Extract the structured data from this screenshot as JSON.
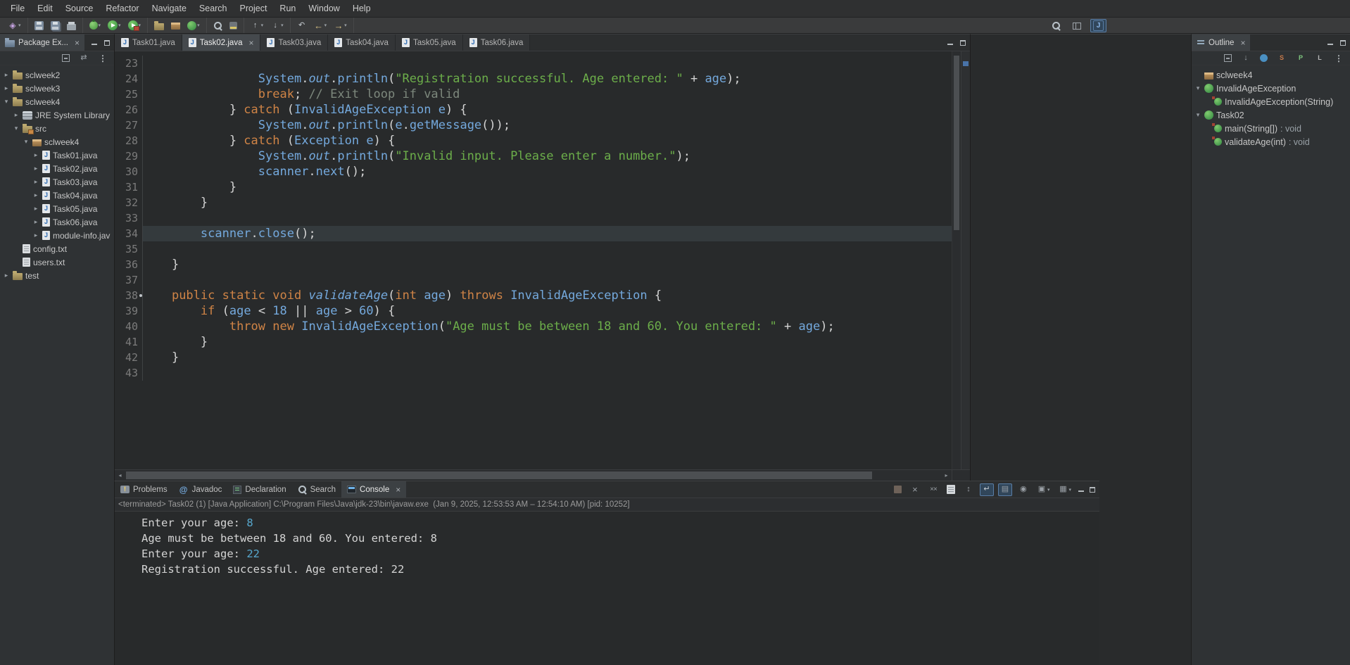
{
  "colors": {
    "keyword": "#d08446",
    "string": "#6cae4a",
    "comment": "#7d887d",
    "blue": "#74a9dd",
    "plain": "#d4d4d4",
    "stdin": "#57a8ce",
    "accent": "#4973a8"
  },
  "menubar": {
    "items": [
      "File",
      "Edit",
      "Source",
      "Refactor",
      "Navigate",
      "Search",
      "Project",
      "Run",
      "Window",
      "Help"
    ]
  },
  "toolbar": {
    "groups": [
      [
        {
          "name": "new-wizard-icon",
          "dropdown": true
        }
      ],
      [
        {
          "name": "save-icon"
        },
        {
          "name": "save-all-icon"
        },
        {
          "name": "print-icon"
        }
      ],
      [
        {
          "name": "debug-icon",
          "dropdown": true
        },
        {
          "name": "run-icon",
          "dropdown": true
        },
        {
          "name": "external-tools-icon",
          "dropdown": true
        }
      ],
      [
        {
          "name": "new-java-project-icon"
        },
        {
          "name": "new-package-icon"
        },
        {
          "name": "new-class-icon",
          "dropdown": true
        }
      ],
      [
        {
          "name": "search-toolbar-icon"
        },
        {
          "name": "mark-occurrences-icon"
        }
      ],
      [
        {
          "name": "previous-annotation-icon",
          "dropdown": true
        },
        {
          "name": "next-annotation-icon",
          "dropdown": true
        }
      ],
      [
        {
          "name": "last-edit-location-icon"
        },
        {
          "name": "back-icon",
          "dropdown": true
        },
        {
          "name": "forward-icon",
          "dropdown": true
        }
      ]
    ],
    "right": [
      {
        "name": "search-icon"
      },
      {
        "name": "open-perspective-icon"
      },
      {
        "name": "java-perspective-icon",
        "active": true
      }
    ]
  },
  "package_explorer": {
    "title": "Package Ex...",
    "tools": [
      {
        "name": "collapse-all-icon"
      },
      {
        "name": "link-with-editor-icon"
      },
      {
        "name": "view-menu-icon"
      }
    ],
    "items": [
      {
        "label": "sclweek2",
        "depth": 0,
        "arrow": "col",
        "icon": "java-project-icon"
      },
      {
        "label": "sclweek3",
        "depth": 0,
        "arrow": "col",
        "icon": "java-project-icon"
      },
      {
        "label": "sclweek4",
        "depth": 0,
        "arrow": "exp",
        "icon": "java-project-icon"
      },
      {
        "label": "JRE System Library",
        "depth": 1,
        "arrow": "col",
        "icon": "jre-library-icon"
      },
      {
        "label": "src",
        "depth": 1,
        "arrow": "exp",
        "icon": "source-folder-icon"
      },
      {
        "label": "sclweek4",
        "depth": 2,
        "arrow": "exp",
        "icon": "package-icon"
      },
      {
        "label": "Task01.java",
        "depth": 3,
        "arrow": "col",
        "icon": "java-file-icon"
      },
      {
        "label": "Task02.java",
        "depth": 3,
        "arrow": "col",
        "icon": "java-file-icon"
      },
      {
        "label": "Task03.java",
        "depth": 3,
        "arrow": "col",
        "icon": "java-file-icon"
      },
      {
        "label": "Task04.java",
        "depth": 3,
        "arrow": "col",
        "icon": "java-file-icon"
      },
      {
        "label": "Task05.java",
        "depth": 3,
        "arrow": "col",
        "icon": "java-file-icon"
      },
      {
        "label": "Task06.java",
        "depth": 3,
        "arrow": "col",
        "icon": "java-file-icon"
      },
      {
        "label": "module-info.jav",
        "depth": 3,
        "arrow": "col",
        "icon": "java-file-icon"
      },
      {
        "label": "config.txt",
        "depth": 1,
        "arrow": null,
        "icon": "text-file-icon"
      },
      {
        "label": "users.txt",
        "depth": 1,
        "arrow": null,
        "icon": "text-file-icon"
      },
      {
        "label": "test",
        "depth": 0,
        "arrow": "col",
        "icon": "java-project-icon"
      }
    ]
  },
  "editor": {
    "tabs": [
      {
        "label": "Task01.java"
      },
      {
        "label": "Task02.java",
        "active": true
      },
      {
        "label": "Task03.java"
      },
      {
        "label": "Task04.java"
      },
      {
        "label": "Task05.java"
      },
      {
        "label": "Task06.java"
      }
    ],
    "lines": [
      {
        "no": 23,
        "tokens": []
      },
      {
        "no": 24,
        "tokens": [
          [
            "p",
            "                "
          ],
          [
            "t",
            "System"
          ],
          [
            "p",
            "."
          ],
          [
            "bi",
            "out"
          ],
          [
            "p",
            "."
          ],
          [
            "m",
            "println"
          ],
          [
            "p",
            "("
          ],
          [
            "s",
            "\"Registration successful. Age entered: \""
          ],
          [
            "p",
            " + "
          ],
          [
            "v",
            "age"
          ],
          [
            "p",
            ");"
          ]
        ]
      },
      {
        "no": 25,
        "tokens": [
          [
            "p",
            "                "
          ],
          [
            "k",
            "break"
          ],
          [
            "p",
            "; "
          ],
          [
            "c",
            "// Exit loop if valid"
          ]
        ]
      },
      {
        "no": 26,
        "tokens": [
          [
            "p",
            "            } "
          ],
          [
            "k",
            "catch"
          ],
          [
            "p",
            " ("
          ],
          [
            "t",
            "InvalidAgeException"
          ],
          [
            "p",
            " "
          ],
          [
            "v",
            "e"
          ],
          [
            "p",
            ") {"
          ]
        ]
      },
      {
        "no": 27,
        "tokens": [
          [
            "p",
            "                "
          ],
          [
            "t",
            "System"
          ],
          [
            "p",
            "."
          ],
          [
            "bi",
            "out"
          ],
          [
            "p",
            "."
          ],
          [
            "m",
            "println"
          ],
          [
            "p",
            "("
          ],
          [
            "v",
            "e"
          ],
          [
            "p",
            "."
          ],
          [
            "m",
            "getMessage"
          ],
          [
            "p",
            "());"
          ]
        ]
      },
      {
        "no": 28,
        "tokens": [
          [
            "p",
            "            } "
          ],
          [
            "k",
            "catch"
          ],
          [
            "p",
            " ("
          ],
          [
            "t",
            "Exception"
          ],
          [
            "p",
            " "
          ],
          [
            "v",
            "e"
          ],
          [
            "p",
            ") {"
          ]
        ]
      },
      {
        "no": 29,
        "tokens": [
          [
            "p",
            "                "
          ],
          [
            "t",
            "System"
          ],
          [
            "p",
            "."
          ],
          [
            "bi",
            "out"
          ],
          [
            "p",
            "."
          ],
          [
            "m",
            "println"
          ],
          [
            "p",
            "("
          ],
          [
            "s",
            "\"Invalid input. Please enter a number.\""
          ],
          [
            "p",
            ");"
          ]
        ]
      },
      {
        "no": 30,
        "tokens": [
          [
            "p",
            "                "
          ],
          [
            "v",
            "scanner"
          ],
          [
            "p",
            "."
          ],
          [
            "m",
            "next"
          ],
          [
            "p",
            "();"
          ]
        ]
      },
      {
        "no": 31,
        "tokens": [
          [
            "p",
            "            }"
          ]
        ]
      },
      {
        "no": 32,
        "tokens": [
          [
            "p",
            "        }"
          ]
        ]
      },
      {
        "no": 33,
        "tokens": []
      },
      {
        "no": 34,
        "highlight": true,
        "tokens": [
          [
            "p",
            "        "
          ],
          [
            "v",
            "scanner"
          ],
          [
            "p",
            "."
          ],
          [
            "m",
            "close"
          ],
          [
            "p",
            "();"
          ]
        ]
      },
      {
        "no": 35,
        "tokens": []
      },
      {
        "no": 36,
        "tokens": [
          [
            "p",
            "    }"
          ]
        ]
      },
      {
        "no": 37,
        "tokens": []
      },
      {
        "no": 38,
        "marker": true,
        "tokens": [
          [
            "p",
            "    "
          ],
          [
            "k",
            "public"
          ],
          [
            "p",
            " "
          ],
          [
            "k",
            "static"
          ],
          [
            "p",
            " "
          ],
          [
            "k",
            "void"
          ],
          [
            "p",
            " "
          ],
          [
            "mi",
            "validateAge"
          ],
          [
            "p",
            "("
          ],
          [
            "k",
            "int"
          ],
          [
            "p",
            " "
          ],
          [
            "v",
            "age"
          ],
          [
            "p",
            ") "
          ],
          [
            "k",
            "throws"
          ],
          [
            "p",
            " "
          ],
          [
            "t",
            "InvalidAgeException"
          ],
          [
            "p",
            " {"
          ]
        ]
      },
      {
        "no": 39,
        "tokens": [
          [
            "p",
            "        "
          ],
          [
            "k",
            "if"
          ],
          [
            "p",
            " ("
          ],
          [
            "v",
            "age"
          ],
          [
            "p",
            " < "
          ],
          [
            "n",
            "18"
          ],
          [
            "p",
            " || "
          ],
          [
            "v",
            "age"
          ],
          [
            "p",
            " > "
          ],
          [
            "n",
            "60"
          ],
          [
            "p",
            ") {"
          ]
        ]
      },
      {
        "no": 40,
        "tokens": [
          [
            "p",
            "            "
          ],
          [
            "k",
            "throw"
          ],
          [
            "p",
            " "
          ],
          [
            "k",
            "new"
          ],
          [
            "p",
            " "
          ],
          [
            "t",
            "InvalidAgeException"
          ],
          [
            "p",
            "("
          ],
          [
            "s",
            "\"Age must be between 18 and 60. You entered: \""
          ],
          [
            "p",
            " + "
          ],
          [
            "v",
            "age"
          ],
          [
            "p",
            ");"
          ]
        ]
      },
      {
        "no": 41,
        "tokens": [
          [
            "p",
            "        }"
          ]
        ]
      },
      {
        "no": 42,
        "tokens": [
          [
            "p",
            "    }"
          ]
        ]
      },
      {
        "no": 43,
        "tokens": []
      }
    ]
  },
  "outline": {
    "title": "Outline",
    "tools": [
      {
        "name": "collapse-all-icon"
      },
      {
        "name": "sort-icon"
      },
      {
        "name": "hide-fields-icon"
      },
      {
        "name": "hide-static-icon"
      },
      {
        "name": "hide-non-public-icon"
      },
      {
        "name": "hide-local-types-icon"
      },
      {
        "name": "view-menu-icon"
      }
    ],
    "items": [
      {
        "label": "sclweek4",
        "depth": 0,
        "arrow": null,
        "icon": "package-icon"
      },
      {
        "label": "InvalidAgeException",
        "depth": 0,
        "arrow": "exp",
        "icon": "class-icon"
      },
      {
        "label": "InvalidAgeException(String)",
        "depth": 1,
        "arrow": null,
        "icon": "constructor-icon"
      },
      {
        "label": "Task02",
        "depth": 0,
        "arrow": "exp",
        "icon": "class-icon"
      },
      {
        "label": "main(String[])",
        "type": " : void",
        "depth": 1,
        "arrow": null,
        "icon": "method-static-icon"
      },
      {
        "label": "validateAge(int)",
        "type": " : void",
        "depth": 1,
        "arrow": null,
        "icon": "method-static-icon"
      }
    ]
  },
  "console_panel": {
    "tabs": [
      {
        "label": "Problems",
        "icon": "problems-icon"
      },
      {
        "label": "Javadoc",
        "icon": "javadoc-icon"
      },
      {
        "label": "Declaration",
        "icon": "declaration-icon"
      },
      {
        "label": "Search",
        "icon": "search-icon"
      },
      {
        "label": "Console",
        "icon": "console-icon",
        "active": true,
        "closable": true
      }
    ],
    "toolbar": [
      {
        "name": "terminate-icon"
      },
      {
        "name": "remove-launch-icon"
      },
      {
        "name": "remove-all-launches-icon"
      },
      {
        "name": "clear-console-icon"
      },
      {
        "name": "scroll-lock-icon"
      },
      {
        "name": "word-wrap-icon",
        "active": true
      },
      {
        "name": "activate-on-output-icon",
        "active": true
      },
      {
        "name": "pin-console-icon"
      },
      {
        "name": "display-selected-console-icon",
        "dropdown": true
      },
      {
        "name": "open-console-icon",
        "dropdown": true
      }
    ],
    "status": "<terminated> Task02 (1) [Java Application] C:\\Program Files\\Java\\jdk-23\\bin\\javaw.exe  (Jan 9, 2025, 12:53:53 AM – 12:54:10 AM) [pid: 10252]",
    "lines": [
      {
        "segments": [
          [
            "out",
            "Enter your age: "
          ],
          [
            "in",
            "8"
          ]
        ]
      },
      {
        "segments": [
          [
            "out",
            "Age must be between 18 and 60. You entered: 8"
          ]
        ]
      },
      {
        "segments": [
          [
            "out",
            "Enter your age: "
          ],
          [
            "in",
            "22"
          ]
        ]
      },
      {
        "segments": [
          [
            "out",
            "Registration successful. Age entered: 22"
          ]
        ]
      }
    ]
  }
}
